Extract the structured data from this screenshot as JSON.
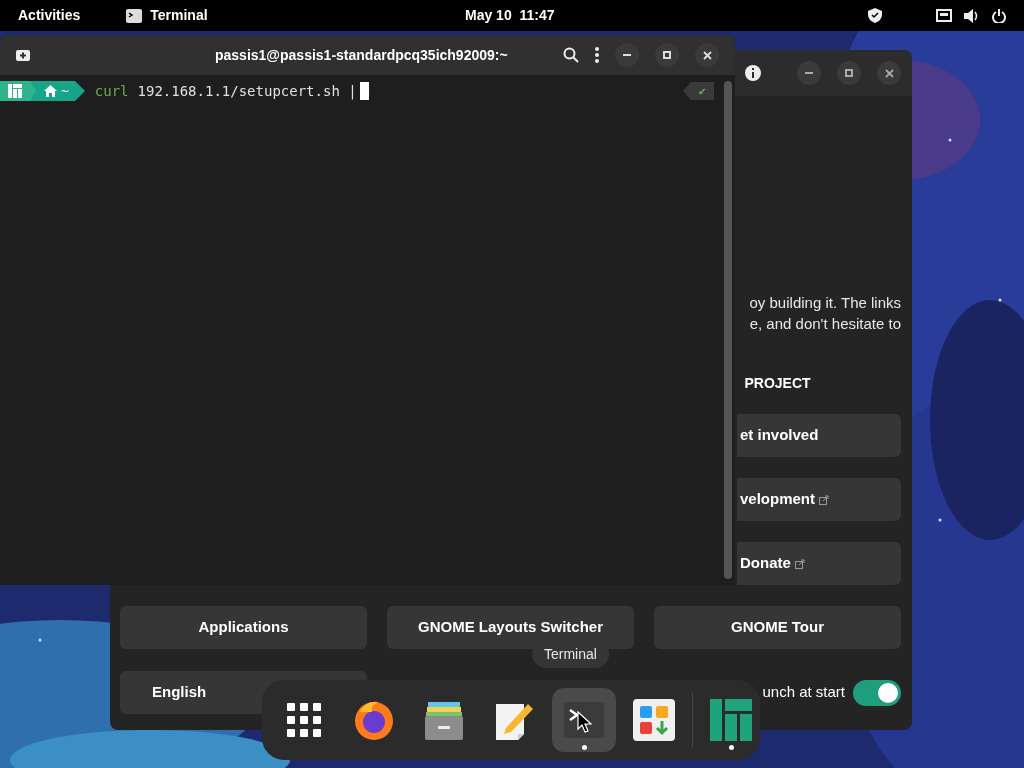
{
  "top_bar": {
    "activities": "Activities",
    "app": "Terminal",
    "clock": "May 10  11:47"
  },
  "terminal": {
    "title": "passis1@passis1-standardpcq35ich92009:~",
    "dir": "~",
    "command": "curl",
    "args": "192.168.1.1/setupcert.sh |",
    "status": "✔"
  },
  "welcome": {
    "text_lines": [
      "oy building it. The links",
      "e, and don't hesitate to"
    ],
    "section": "PROJECT",
    "links": [
      {
        "label": "et involved",
        "external": false
      },
      {
        "label": "velopment",
        "external": true
      },
      {
        "label": "Donate",
        "external": true
      }
    ],
    "buttons": [
      "Applications",
      "GNOME Layouts Switcher",
      "GNOME Tour"
    ],
    "language": "English",
    "launch": {
      "label": "unch at start",
      "on": true
    }
  },
  "dock": {
    "tooltip": "Terminal",
    "apps": [
      {
        "kind": "grid",
        "running": false,
        "hovered": false
      },
      {
        "kind": "browser",
        "running": false,
        "hovered": false
      },
      {
        "kind": "files",
        "running": false,
        "hovered": false
      },
      {
        "kind": "editor",
        "running": false,
        "hovered": false
      },
      {
        "kind": "terminal",
        "running": true,
        "hovered": true
      },
      {
        "kind": "software",
        "running": false,
        "hovered": false
      },
      {
        "kind": "manjaro",
        "running": true,
        "hovered": false
      }
    ]
  }
}
